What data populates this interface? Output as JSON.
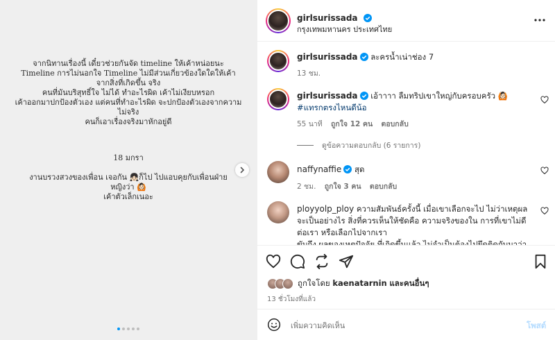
{
  "media": {
    "paragraph1": [
      "จากนิทานเรื่องนี้ เดี๋ยวช่วยกันจัด timeline ให้เค้าหน่อยนะ",
      "Timeline การไม่นอกใจ Timeline ไม่มีส่วนเกี่ยวข้องใดใดให้เค้า",
      "จากสิ่งที่เกิดขึ้น จริง"
    ],
    "paragraph2": [
      "คนที่มันบริสุทธิ์ใจ ไม่ได้ ทำอะไรผิด เค้าไม่เงียบหรอก",
      "เค้าออกมาปกป้องตัวเอง แต่คนที่ทำอะไรผิด จะปกป้องตัวเองจากความ",
      "ไม่จริง",
      "คนก็เอาเรื่องจริงมาหักอยู่ดี"
    ],
    "paragraph3": [
      "18 มกรา"
    ],
    "paragraph4": [
      "งานบรวงสวงของเพื่อน  เจอกัน 👧🏻ก็ไป ไปแอบคุยกับเพื่อนฝ่าย",
      "หญิงว่า 🙆🏻",
      "เค้าตัวเล็กเนอะ"
    ],
    "slide_count": 5,
    "active_slide": 1
  },
  "header": {
    "username": "girlsurissada",
    "location": "กรุงเทพมหานคร ประเทศไทย"
  },
  "comments": [
    {
      "username": "girlsurissada",
      "text": "ละครน้ำเน่าช่อง 7",
      "time": "13 ชม."
    },
    {
      "username": "girlsurissada",
      "text": "เอ้าาาา ลืมทริปเขาใหญ่กับครอบครัว 🙆🏻",
      "hashtag": "#แทรกตรงไหนดีน้อ",
      "time": "55 นาที",
      "likes": "ถูกใจ 12 คน",
      "reply": "ตอบกลับ",
      "view_replies": "ดูข้อความตอบกลับ (6 รายการ)"
    },
    {
      "username": "naffynaffie",
      "text": "สุด",
      "time": "2 ชม.",
      "likes": "ถูกใจ 3 คน",
      "reply": "ตอบกลับ"
    },
    {
      "username": "ployyolp_ploy",
      "text": "ความสัมพันธ์ครั้งนี้ เมื่อเขาเลือกจะไป ไม่ว่าเหตุผลจะเป็นอย่างไร สิ่งที่ควรเห็นให้ชัดคือ ความจริงของใน การที่เขาไม่ดีต่อเรา หรือเลือกไปจากเรา",
      "text_partial": "ขับถึง ผลของเหตุปัจจัย ที่เกิดขึ้นแล้ว ไม่จำเป็นต้องไปยึดติดกับมาว่า"
    }
  ],
  "post": {
    "liked_by": "ถูกใจโดย",
    "liked_by_user": "kaenatarnin",
    "liked_by_suffix": "และคนอื่นๆ",
    "time_ago": "13 ชั่วโมงที่แล้ว"
  },
  "add_comment": {
    "placeholder": "เพิ่มความคิดเห็น",
    "post_label": "โพสต์"
  },
  "colors": {
    "verified": "#0095f6",
    "link": "#00376b",
    "post_disabled": "#b3dbff",
    "muted": "#737373"
  },
  "icons": [
    "verified-icon",
    "more-icon",
    "heart-icon",
    "comment-icon",
    "share-icon",
    "save-icon",
    "smile-icon",
    "chevron-right-icon"
  ]
}
